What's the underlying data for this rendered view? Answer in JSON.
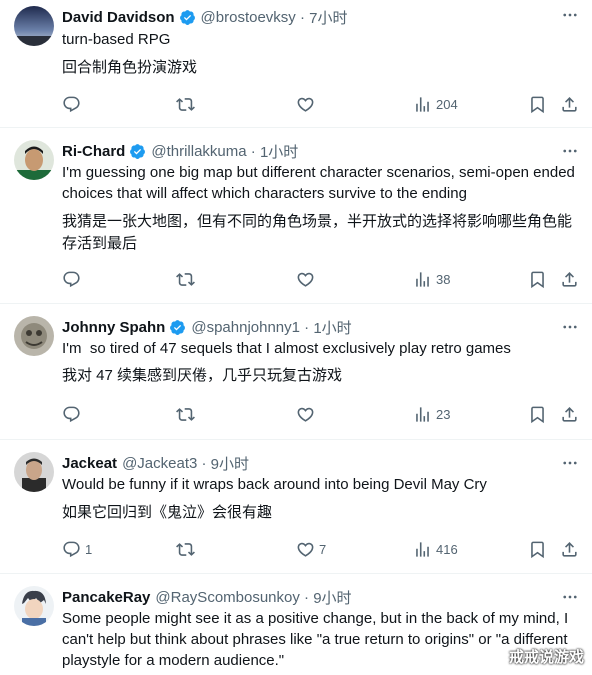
{
  "tweets": [
    {
      "name": "David Davidson",
      "handle": "@brostoevksy",
      "time": "7小时",
      "lines": [
        "turn-based RPG",
        "回合制角色扮演游戏"
      ],
      "replies": "",
      "retweets": "",
      "likes": "",
      "views": "204"
    },
    {
      "name": "Ri-Chard",
      "handle": "@thrillakkuma",
      "time": "1小时",
      "lines": [
        "I'm guessing one big map but different character scenarios, semi-open ended choices that will affect which characters survive to the ending",
        "我猜是一张大地图，但有不同的角色场景，半开放式的选择将影响哪些角色能存活到最后"
      ],
      "replies": "",
      "retweets": "",
      "likes": "",
      "views": "38"
    },
    {
      "name": "Johnny Spahn",
      "handle": "@spahnjohnny1",
      "time": "1小时",
      "lines": [
        "I'm  so tired of 47 sequels that I almost exclusively play retro games",
        "我对 47 续集感到厌倦，几乎只玩复古游戏"
      ],
      "replies": "",
      "retweets": "",
      "likes": "",
      "views": "23"
    },
    {
      "name": "Jackeat",
      "handle": "@Jackeat3",
      "time": "9小时",
      "lines": [
        "Would be funny if it wraps back around into being Devil May Cry",
        "如果它回归到《鬼泣》会很有趣"
      ],
      "replies": "1",
      "retweets": "",
      "likes": "7",
      "views": "416"
    },
    {
      "name": "PancakeRay",
      "handle": "@RayScombosunkoy",
      "time": "9小时",
      "lines": [
        "Some people might see it as a positive change, but in the back of my mind, I can't help but think about phrases like \"a true return to origins\" or \"a different playstyle for a modern audience.\""
      ]
    }
  ],
  "watermark": "戒戒说游戏",
  "colors": {
    "verified": "#1d9bf0",
    "muted": "#536471",
    "text": "#0f1419",
    "border": "#eff3f4"
  }
}
